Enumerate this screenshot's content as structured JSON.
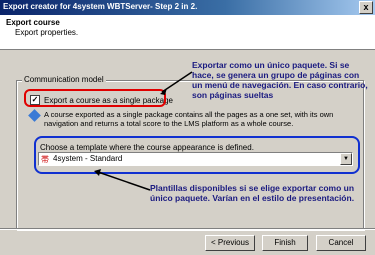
{
  "window": {
    "title": "Export creator for 4system WBTServer- Step 2 in 2.",
    "close_label": "x"
  },
  "header": {
    "title": "Export course",
    "subtitle": "Export properties."
  },
  "group": {
    "label": "Communication model"
  },
  "checkbox": {
    "label": "Export a course as a single package",
    "checked": true,
    "check_glyph": "✓"
  },
  "info": {
    "text": "A course exported as a single package contains all the pages as a one set, with its own navigation and returns a total score to the LMS platform as a whole course."
  },
  "template": {
    "label": "Choose a template where the course appearance is defined.",
    "selected": "4system - Standard",
    "arrow": "▼",
    "icon": "帯"
  },
  "buttons": {
    "back": "< Previous",
    "finish": "Finish",
    "cancel": "Cancel"
  },
  "annotations": {
    "note1": "Exportar como un único paquete. Si se hace, se genera un grupo de páginas con un menú de navegación. En caso contrario, son páginas sueltas",
    "note2": "Plantillas disponibles si se elige exportar como un único paquete. Varían en el estilo de presentación.",
    "red": "#e00000",
    "blue": "#1030d0"
  }
}
